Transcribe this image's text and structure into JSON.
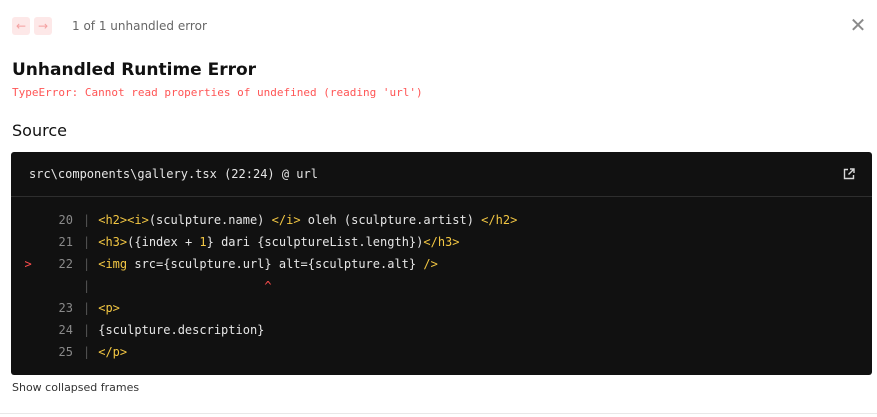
{
  "nav": {
    "prev_glyph": "←",
    "next_glyph": "→",
    "error_count": "1 of 1 unhandled error"
  },
  "close_glyph": "✕",
  "error": {
    "title": "Unhandled Runtime Error",
    "message": "TypeError: Cannot read properties of undefined (reading 'url')"
  },
  "source": {
    "heading": "Source",
    "file": "src\\components\\gallery.tsx (22:24) @ url",
    "lines": [
      {
        "marker": "",
        "num": "20",
        "parts": [
          [
            "tag",
            "<h2><i>"
          ],
          [
            "code",
            "(sculpture.name) "
          ],
          [
            "tag",
            "</i>"
          ],
          [
            "code",
            " oleh (sculpture.artist) "
          ],
          [
            "tag",
            "</h2>"
          ]
        ]
      },
      {
        "marker": "",
        "num": "21",
        "parts": [
          [
            "tag",
            "<h3>"
          ],
          [
            "code",
            "({index + "
          ],
          [
            "num",
            "1"
          ],
          [
            "code",
            "} dari {sculptureList.length})"
          ],
          [
            "tag",
            "</h3>"
          ]
        ]
      },
      {
        "marker": ">",
        "num": "22",
        "parts": [
          [
            "tag",
            "<img "
          ],
          [
            "code",
            "src={sculpture.url} alt={sculpture.alt} "
          ],
          [
            "tag",
            "/>"
          ]
        ]
      },
      {
        "marker": "",
        "num": "",
        "parts": [
          [
            "code",
            "                       ^"
          ]
        ]
      },
      {
        "marker": "",
        "num": "23",
        "parts": [
          [
            "tag",
            "<p>"
          ]
        ]
      },
      {
        "marker": "",
        "num": "24",
        "parts": [
          [
            "code",
            "{sculpture.description}"
          ]
        ]
      },
      {
        "marker": "",
        "num": "25",
        "parts": [
          [
            "tag",
            "</p>"
          ]
        ]
      }
    ]
  },
  "footer": "Show collapsed frames",
  "colors": {
    "error_red": "#ff5555",
    "tag_yellow": "#f3c743",
    "code_bg": "#111111"
  }
}
